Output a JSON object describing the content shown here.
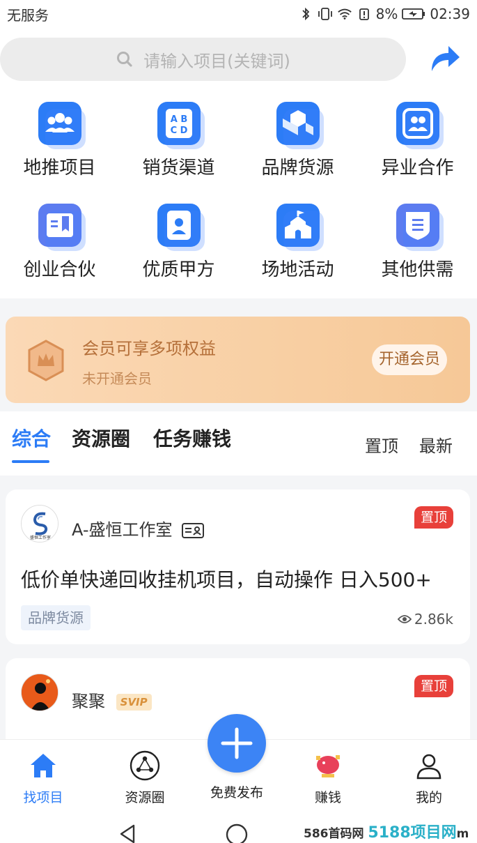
{
  "status_bar": {
    "carrier": "无服务",
    "battery": "8%",
    "time": "02:39"
  },
  "search": {
    "placeholder": "请输入项目(关键词)"
  },
  "categories": [
    {
      "label": "地推项目",
      "icon": "people-icon"
    },
    {
      "label": "销货渠道",
      "icon": "abcd-icon"
    },
    {
      "label": "品牌货源",
      "icon": "cubes-icon"
    },
    {
      "label": "异业合作",
      "icon": "group-icon"
    },
    {
      "label": "创业合伙",
      "icon": "book-icon"
    },
    {
      "label": "优质甲方",
      "icon": "user-card-icon"
    },
    {
      "label": "场地活动",
      "icon": "building-icon"
    },
    {
      "label": "其他供需",
      "icon": "shield-list-icon"
    }
  ],
  "vip_banner": {
    "title": "会员可享多项权益",
    "subtitle": "未开通会员",
    "button": "开通会员"
  },
  "tabs": {
    "items": [
      "综合",
      "资源圈",
      "任务赚钱"
    ],
    "active": "综合",
    "sort_top": "置顶",
    "sort_new": "最新"
  },
  "posts": [
    {
      "author": "A-盛恒工作室",
      "avatar_text": "盛恒工作室",
      "pin": "置顶",
      "title": "低价单快递回收挂机项目，自动操作 日入500+",
      "tag": "品牌货源",
      "views": "2.86k"
    },
    {
      "author": "聚聚",
      "badge": "SVIP",
      "pin": "置顶"
    }
  ],
  "tabbar": {
    "home": "找项目",
    "circle": "资源圈",
    "publish": "免费发布",
    "earn": "赚钱",
    "mine": "我的"
  },
  "watermark": {
    "text": "586首码网",
    "brand": "5188项目网",
    "url_fragment": "m"
  },
  "colors": {
    "accent": "#2c7cf6",
    "pin": "#e8403a",
    "vip_text": "#b5703a"
  }
}
